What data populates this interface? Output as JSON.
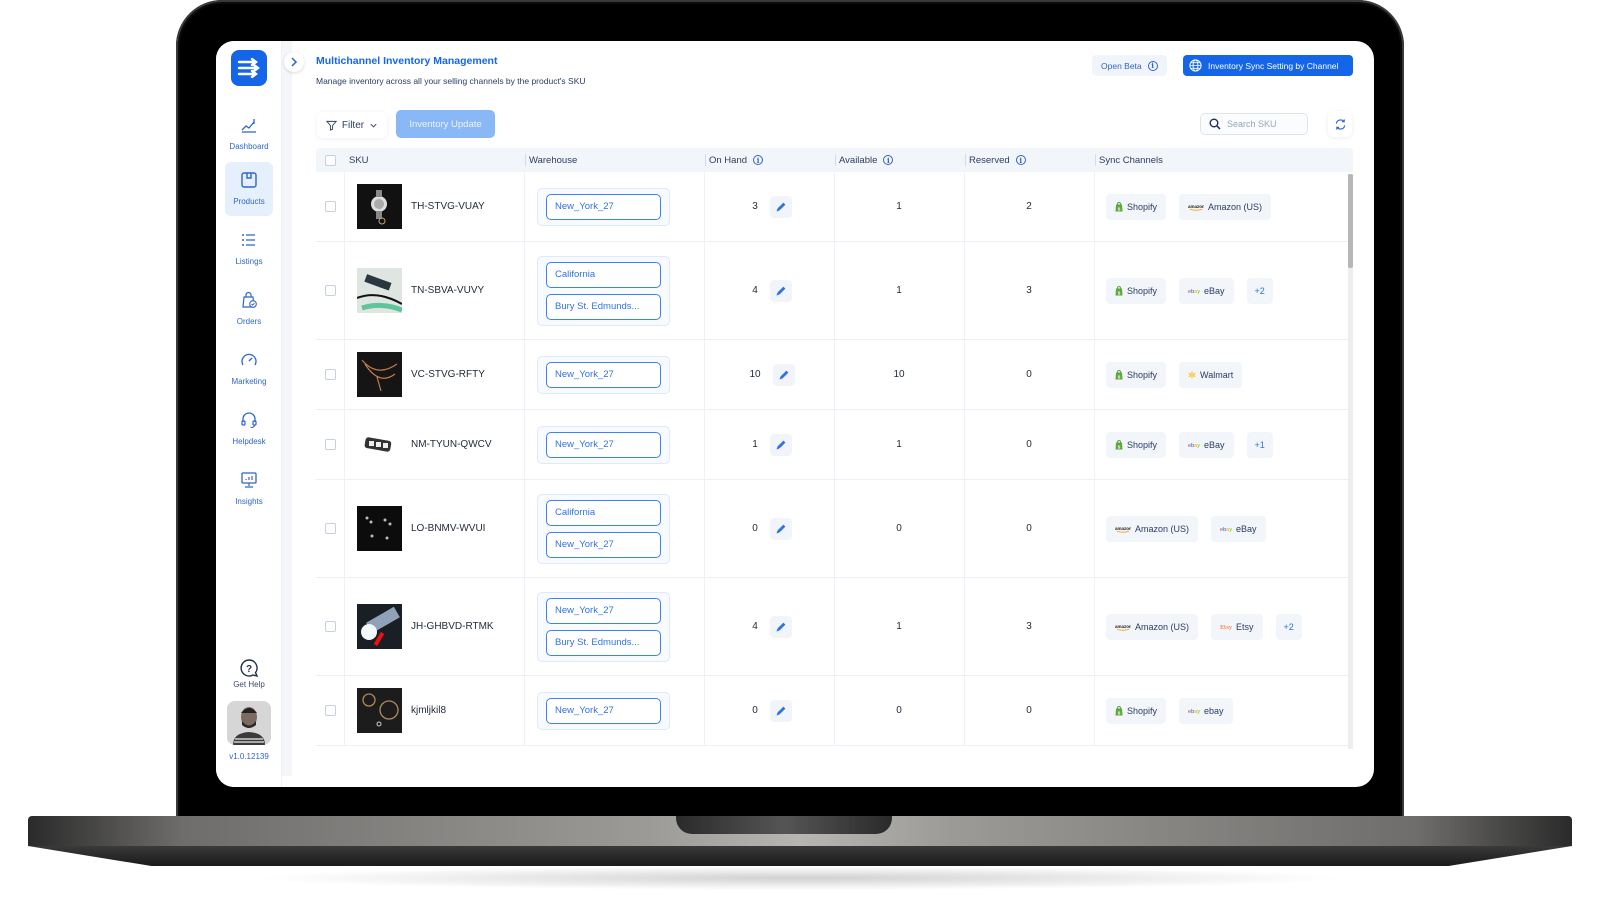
{
  "app": {
    "title": "Multichannel Inventory Management",
    "subtitle": "Manage inventory across  all your selling channels  by the product's SKU",
    "brand_color": "#1565e8",
    "version": "v1.0.12139"
  },
  "sidebar": {
    "items": [
      {
        "label": "Dashboard",
        "icon": "chart-line-icon",
        "active": false
      },
      {
        "label": "Products",
        "icon": "box-icon",
        "active": true
      },
      {
        "label": "Listings",
        "icon": "list-icon",
        "active": false
      },
      {
        "label": "Orders",
        "icon": "shopping-bag-icon",
        "active": false
      },
      {
        "label": "Marketing",
        "icon": "speedometer-icon",
        "active": false
      },
      {
        "label": "Helpdesk",
        "icon": "headset-icon",
        "active": false
      },
      {
        "label": "Insights",
        "icon": "monitor-chart-icon",
        "active": false
      }
    ],
    "help_label": "Get Help"
  },
  "header": {
    "open_beta_label": "Open Beta",
    "sync_setting_label": "Inventory Sync Setting by Channel"
  },
  "toolbar": {
    "filter_label": "Filter",
    "inventory_update_label": "Inventory Update",
    "search_placeholder": "Search SKU"
  },
  "table": {
    "columns": [
      "SKU",
      "Warehouse",
      "On Hand",
      "Available",
      "Reserved",
      "Sync Channels"
    ],
    "rows": [
      {
        "sku": "TH-STVG-VUAY",
        "warehouses": [
          "New_York_27"
        ],
        "on_hand": "3",
        "available": "1",
        "reserved": "2",
        "channels": [
          "Shopify",
          "Amazon (US)"
        ],
        "more": ""
      },
      {
        "sku": "TN-SBVA-VUVY",
        "warehouses": [
          "California",
          "Bury St. Edmunds..."
        ],
        "on_hand": "4",
        "available": "1",
        "reserved": "3",
        "channels": [
          "Shopify",
          "eBay"
        ],
        "more": "+2"
      },
      {
        "sku": "VC-STVG-RFTY",
        "warehouses": [
          "New_York_27"
        ],
        "on_hand": "10",
        "available": "10",
        "reserved": "0",
        "channels": [
          "Shopify",
          "Walmart"
        ],
        "more": ""
      },
      {
        "sku": "NM-TYUN-QWCV",
        "warehouses": [
          "New_York_27"
        ],
        "on_hand": "1",
        "available": "1",
        "reserved": "0",
        "channels": [
          "Shopify",
          "eBay"
        ],
        "more": "+1"
      },
      {
        "sku": "LO-BNMV-WVUI",
        "warehouses": [
          "California",
          "New_York_27"
        ],
        "on_hand": "0",
        "available": "0",
        "reserved": "0",
        "channels": [
          "Amazon (US)",
          "eBay"
        ],
        "more": ""
      },
      {
        "sku": "JH-GHBVD-RTMK",
        "warehouses": [
          "New_York_27",
          "Bury St. Edmunds..."
        ],
        "on_hand": "4",
        "available": "1",
        "reserved": "3",
        "channels": [
          "Amazon (US)",
          "Etsy"
        ],
        "more": "+2"
      },
      {
        "sku": "kjmljkil8",
        "warehouses": [
          "New_York_27"
        ],
        "on_hand": "0",
        "available": "0",
        "reserved": "0",
        "channels": [
          "Shopify",
          "ebay"
        ],
        "more": ""
      }
    ]
  }
}
